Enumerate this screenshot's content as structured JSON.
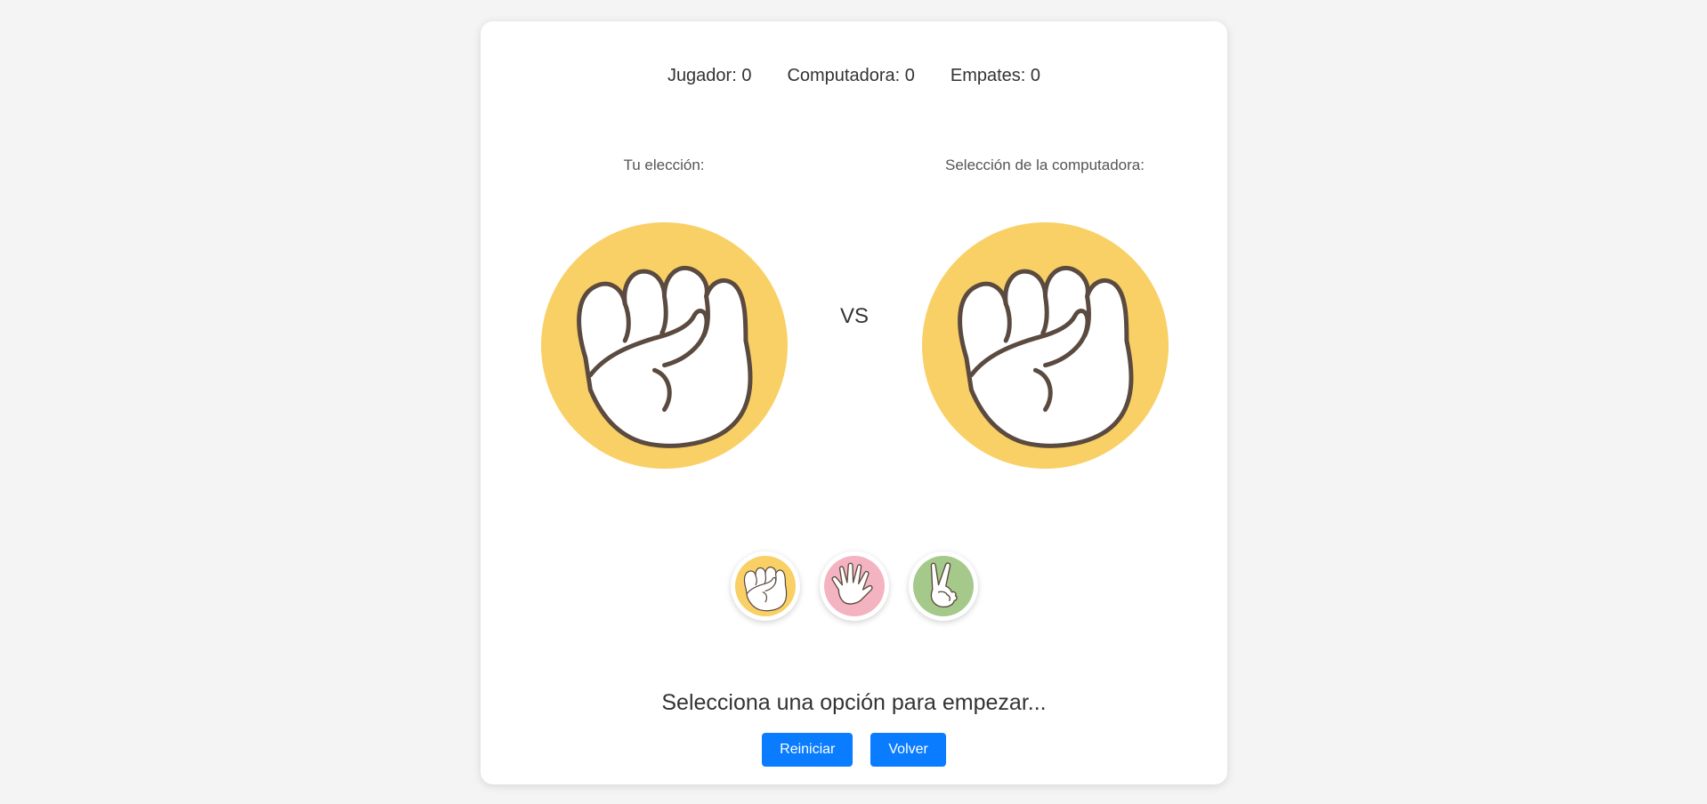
{
  "scoreboard": {
    "player": "Jugador: 0",
    "computer": "Computadora: 0",
    "ties": "Empates: 0"
  },
  "player_panel": {
    "label": "Tu elección:",
    "choice_icon": "rock-icon"
  },
  "computer_panel": {
    "label": "Selección de la computadora:",
    "choice_icon": "rock-icon"
  },
  "vs_text": "VS",
  "options": [
    {
      "name": "rock",
      "icon": "rock-icon",
      "color": "#f9d065"
    },
    {
      "name": "paper",
      "icon": "paper-icon",
      "color": "#f4b3c0"
    },
    {
      "name": "scissors",
      "icon": "scissors-icon",
      "color": "#a4c98a"
    }
  ],
  "status_message": "Selecciona una opción para empezar...",
  "buttons": {
    "reset": "Reiniciar",
    "back": "Volver"
  },
  "colors": {
    "accent": "#0a7cff",
    "rock": "#f9d065",
    "paper": "#f4b3c0",
    "scissors": "#a4c98a"
  }
}
